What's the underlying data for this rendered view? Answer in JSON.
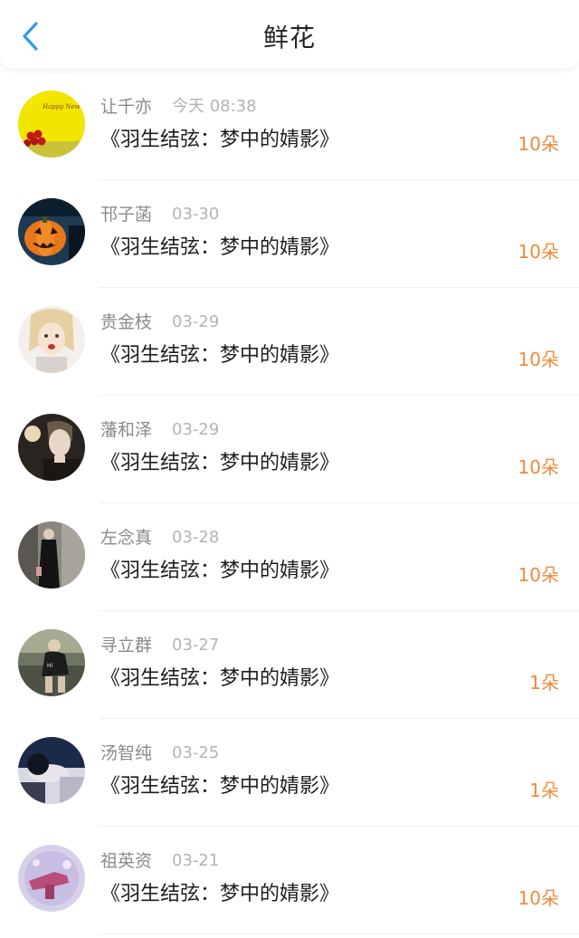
{
  "header": {
    "title": "鲜花",
    "back_icon": "chevron-left-icon",
    "accent_color": "#2f9be8"
  },
  "list": {
    "count_color": "#f08a3c",
    "items": [
      {
        "name": "让千亦",
        "date": "今天 08:38",
        "title": "《羽生结弦：梦中的婧影》",
        "count": "10朵",
        "avatar_text": "Happy New Ye"
      },
      {
        "name": "邗子菡",
        "date": "03-30",
        "title": "《羽生结弦：梦中的婧影》",
        "count": "10朵"
      },
      {
        "name": "贵金枝",
        "date": "03-29",
        "title": "《羽生结弦：梦中的婧影》",
        "count": "10朵"
      },
      {
        "name": "藩和泽",
        "date": "03-29",
        "title": "《羽生结弦：梦中的婧影》",
        "count": "10朵"
      },
      {
        "name": "左念真",
        "date": "03-28",
        "title": "《羽生结弦：梦中的婧影》",
        "count": "10朵"
      },
      {
        "name": "寻立群",
        "date": "03-27",
        "title": "《羽生结弦：梦中的婧影》",
        "count": "1朵"
      },
      {
        "name": "汤智纯",
        "date": "03-25",
        "title": "《羽生结弦：梦中的婧影》",
        "count": "1朵"
      },
      {
        "name": "祖英资",
        "date": "03-21",
        "title": "《羽生结弦：梦中的婧影》",
        "count": "10朵"
      }
    ]
  }
}
